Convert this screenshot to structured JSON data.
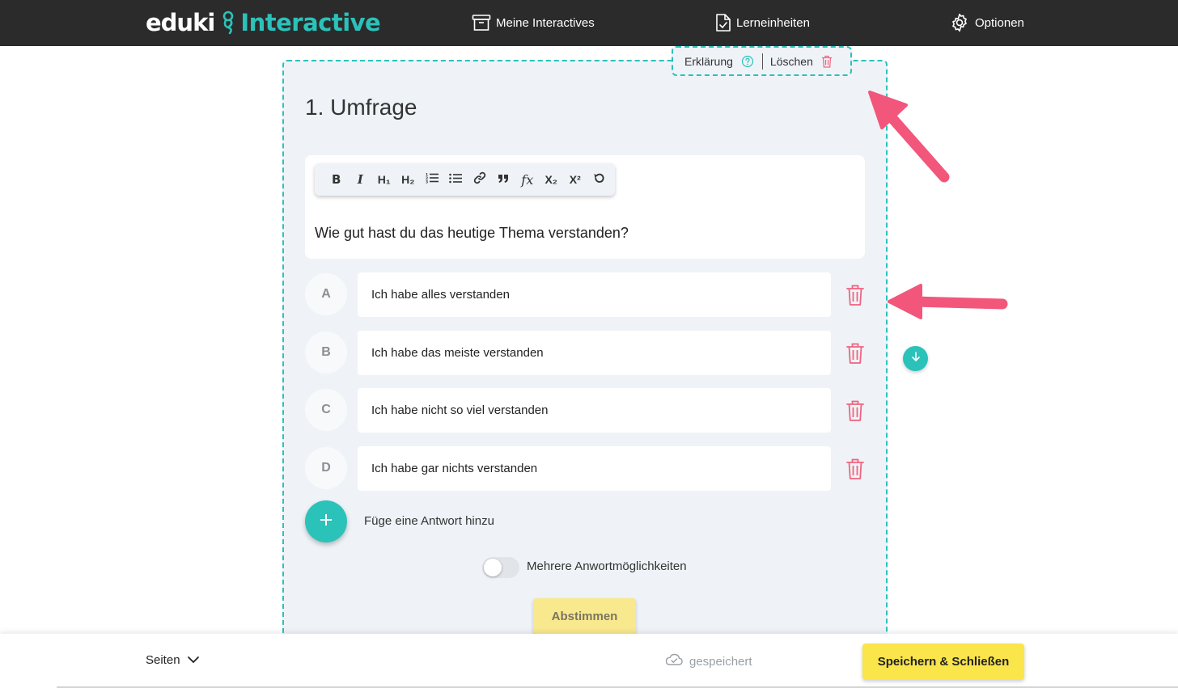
{
  "header": {
    "logo_left": "eduki",
    "logo_right": "Interactive",
    "nav": [
      {
        "label": "Meine Interactives",
        "icon": "archive-box-icon"
      },
      {
        "label": "Lerneinheiten",
        "icon": "document-check-icon"
      },
      {
        "label": "Optionen",
        "icon": "gear-icon"
      }
    ]
  },
  "card": {
    "actions": {
      "explain_label": "Erklärung",
      "delete_label": "Löschen"
    },
    "title": "1. Umfrage",
    "toolbar": [
      "B",
      "I",
      "H₁",
      "H₂",
      "ordered-list",
      "bullet-list",
      "link",
      "quote",
      "formula",
      "X₂",
      "X²",
      "undo"
    ],
    "question": "Wie gut hast du das heutige Thema verstanden?",
    "options": [
      {
        "letter": "A",
        "text": "Ich habe alles verstanden"
      },
      {
        "letter": "B",
        "text": "Ich habe das meiste verstanden"
      },
      {
        "letter": "C",
        "text": "Ich habe nicht so viel verstanden"
      },
      {
        "letter": "D",
        "text": "Ich habe gar nichts verstanden"
      }
    ],
    "add_answer_label": "Füge eine Antwort hinzu",
    "multiple_toggle": {
      "label": "Mehrere Anwortmöglichkeiten",
      "enabled": false
    },
    "vote_label": "Abstimmen"
  },
  "footer": {
    "pages_label": "Seiten",
    "saved_label": "gespeichert",
    "save_close_label": "Speichern & Schließen"
  },
  "colors": {
    "accent": "#2bc2ba",
    "danger": "#f0637f",
    "annotation_arrow": "#f2567a",
    "primary_button": "#fae54b",
    "topbar": "#2b2b2b"
  }
}
